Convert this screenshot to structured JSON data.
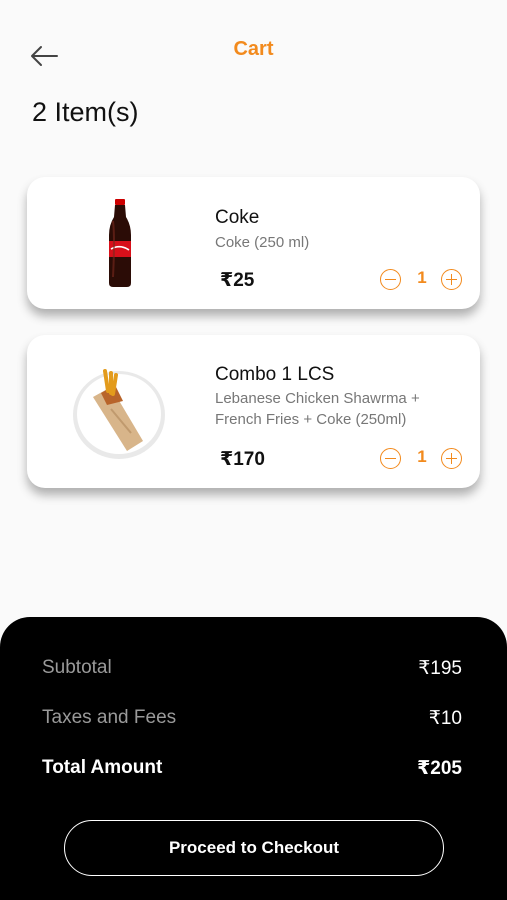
{
  "header": {
    "title": "Cart",
    "back_icon": "arrow-left-icon"
  },
  "cart": {
    "count_label": "2 Item(s)",
    "items": [
      {
        "name": "Coke",
        "description": "Coke (250 ml)",
        "price": "₹25",
        "quantity": "1",
        "image": "coke-bottle-image"
      },
      {
        "name": "Combo 1 LCS",
        "description": "Lebanese Chicken Shawrma + French Fries + Coke (250ml)",
        "price": "₹170",
        "quantity": "1",
        "image": "shawarma-plate-image"
      }
    ]
  },
  "summary": {
    "subtotal_label": "Subtotal",
    "subtotal_value": "₹195",
    "taxes_label": "Taxes and Fees",
    "taxes_value": "₹10",
    "total_label": "Total Amount",
    "total_value": "₹205",
    "checkout_label": "Proceed to Checkout"
  },
  "colors": {
    "accent": "#f28a1d",
    "summary_bg": "#000000",
    "background": "#fafafa"
  }
}
